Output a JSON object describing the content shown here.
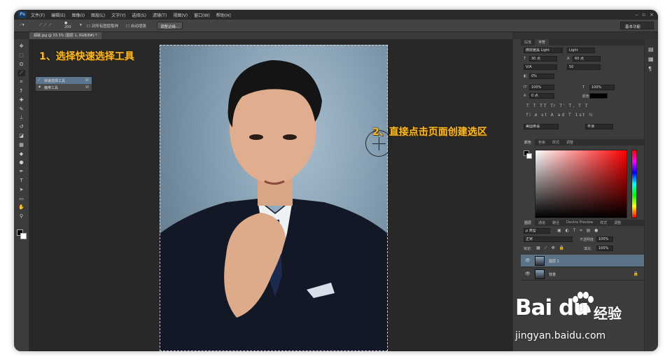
{
  "app": {
    "logo": "Ps"
  },
  "menu": {
    "items": [
      "文件(F)",
      "编辑(E)",
      "图像(I)",
      "图层(L)",
      "文字(Y)",
      "选择(S)",
      "滤镜(T)",
      "视图(V)",
      "窗口(W)",
      "帮助(H)"
    ],
    "window_buttons": [
      "–",
      "▫",
      "×"
    ]
  },
  "options_bar": {
    "brush_size": "200",
    "sample_all_layers": "对所有图层取样",
    "auto_enhance": "自动增强",
    "refine_edge_button": "调整边缘...",
    "workspace": "基本功能"
  },
  "document": {
    "tab_title": "胡歌.jpg @ 33.3% (图层 1, RGB/8#) *"
  },
  "tool_flyout": {
    "items": [
      {
        "label": "快速选择工具",
        "key": "W",
        "selected": true
      },
      {
        "label": "魔棒工具",
        "key": "W",
        "selected": false
      }
    ]
  },
  "annotations": {
    "step1": "1、选择快速选择工具",
    "step2": "2、直接点击页面创建选区"
  },
  "character_panel": {
    "tabs": [
      "段落",
      "字符"
    ],
    "font_family": "微软雅黑 Light",
    "font_style": "Light",
    "font_size": "30 点",
    "leading": "60 点",
    "kerning": "V/A",
    "tracking": "50",
    "vertical_scale": "100%",
    "horizontal_scale": "100%",
    "baseline_shift": "0 点",
    "color_label": "颜色:",
    "tsume": "0%",
    "style_buttons": "T T TT Tr T' T, T T",
    "opentype_buttons": "fi ø st A ad T 1st ½",
    "language": "美国英语",
    "antialias": "平滑"
  },
  "color_panel": {
    "tabs": [
      "颜色",
      "色板",
      "样式",
      "调整"
    ]
  },
  "layers_panel": {
    "tabs": [
      "图层",
      "通道",
      "路径",
      "Device Preview",
      "样式",
      "调整"
    ],
    "filter_kind": "ρ 类型",
    "blend_mode": "正常",
    "opacity_label": "不透明度:",
    "opacity": "100%",
    "lock_label": "锁定:",
    "fill_label": "填充:",
    "fill": "100%",
    "layers": [
      {
        "name": "图层 1",
        "selected": true,
        "locked": false
      },
      {
        "name": "背景",
        "selected": false,
        "locked": true
      }
    ]
  },
  "watermark": {
    "brand": "Bai du",
    "product": "经验",
    "url": "jingyan.baidu.com"
  },
  "icons": [
    "move-icon",
    "marquee-icon",
    "lasso-icon",
    "quick-selection-icon",
    "crop-icon",
    "eyedropper-icon",
    "healing-brush-icon",
    "brush-icon",
    "clone-stamp-icon",
    "history-brush-icon",
    "eraser-icon",
    "gradient-icon",
    "blur-icon",
    "dodge-icon",
    "pen-icon",
    "type-icon",
    "path-selection-icon",
    "shape-icon",
    "hand-icon",
    "zoom-icon"
  ],
  "colors": {
    "ui_dark": "#323232",
    "panel": "#3c3c3c",
    "annotation": "#f7b72a",
    "selected_layer": "#5b7287"
  }
}
